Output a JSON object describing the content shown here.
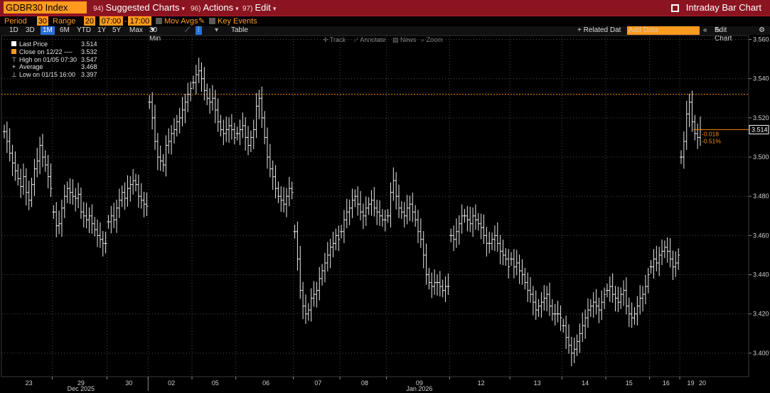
{
  "header": {
    "ticker": "GDBR30 Index",
    "menu_suggested_num": "94)",
    "menu_suggested": "Suggested Charts",
    "menu_actions_num": "96)",
    "menu_actions": "Actions",
    "menu_edit_num": "97)",
    "menu_edit": "Edit",
    "title": "Intraday Bar Chart"
  },
  "controls": {
    "period_label": "Period",
    "period_value": "30",
    "range_label": "Range",
    "range_value": "20",
    "time_start": "07:00",
    "time_sep": "-",
    "time_end": "17:00",
    "mov_avgs": "Mov Avgs",
    "key_events": "Key Events"
  },
  "timeframes": [
    "1D",
    "3D",
    "1M",
    "6M",
    "YTD",
    "1Y",
    "5Y",
    "Max"
  ],
  "timeframe_selected": "1M",
  "interval": "30 Min",
  "table_label": "Table",
  "related_label": "+ Related Dat",
  "add_data_placeholder": "Add Data",
  "edit_chart": "Edit Chart",
  "toolbar": {
    "track": "Track",
    "annotate": "Annotate",
    "news": "News",
    "zoom": "Zoom"
  },
  "legend": [
    {
      "label": "Last Price",
      "value": "3.514"
    },
    {
      "label": "Close on 12/22 ----",
      "value": "3.532"
    },
    {
      "label": "High on 01/05 07:30",
      "value": "3.547"
    },
    {
      "label": "Average",
      "value": "3.468"
    },
    {
      "label": "Low on 01/15 16:00",
      "value": "3.397"
    }
  ],
  "chart_data": {
    "type": "bar",
    "subtype": "intraday-ohlc",
    "ylim": [
      3.388,
      3.562
    ],
    "y_ticks": [
      "3.400",
      "3.420",
      "3.440",
      "3.460",
      "3.480",
      "3.500",
      "3.520",
      "3.540",
      "3.560"
    ],
    "x_ticks": [
      "23",
      "29",
      "30",
      "02",
      "05",
      "06",
      "07",
      "08",
      "09",
      "12",
      "13",
      "14",
      "15",
      "16",
      "19",
      "20"
    ],
    "month_labels": [
      {
        "label": "Dec 2025",
        "after": "29"
      },
      {
        "label": "Jan 2026",
        "after": "09"
      }
    ],
    "reference_line": {
      "label": "Close on 12/22",
      "value": 3.532,
      "color": "#ff8c00"
    },
    "last_price": {
      "value": "3.514",
      "change": "-0.018",
      "change_pct": "-0.51%"
    },
    "grid": true,
    "colors": {
      "bars": "#e8e8e8",
      "grid": "#4a4a4a",
      "reference": "#ff8c00"
    },
    "series": [
      {
        "day": "23",
        "closes": [
          3.513,
          3.508,
          3.502,
          3.497,
          3.493,
          3.489,
          3.485,
          3.49,
          3.482,
          3.478,
          3.486,
          3.494,
          3.498,
          3.506,
          3.5,
          3.496,
          3.49,
          3.484
        ]
      },
      {
        "day": "29",
        "closes": [
          3.472,
          3.465,
          3.466,
          3.474,
          3.48,
          3.484,
          3.482,
          3.48,
          3.479,
          3.481,
          3.472,
          3.47,
          3.468,
          3.47,
          3.466,
          3.463,
          3.46,
          3.458,
          3.456,
          3.456
        ]
      },
      {
        "day": "30",
        "closes": [
          3.467,
          3.47,
          3.468,
          3.474,
          3.478,
          3.482,
          3.479,
          3.484,
          3.486,
          3.488,
          3.486,
          3.48,
          3.478,
          3.476,
          3.475
        ]
      },
      {
        "day": "02",
        "closes": [
          3.528,
          3.52,
          3.508,
          3.5,
          3.498,
          3.496,
          3.506,
          3.508,
          3.512,
          3.514,
          3.518,
          3.52,
          3.524,
          3.528,
          3.532,
          3.535
        ]
      },
      {
        "day": "05",
        "closes": [
          3.538,
          3.542,
          3.544,
          3.54,
          3.534,
          3.53,
          3.528,
          3.53,
          3.524,
          3.518,
          3.514,
          3.512,
          3.514,
          3.516,
          3.514,
          3.51
        ]
      },
      {
        "day": "06",
        "closes": [
          3.512,
          3.514,
          3.516,
          3.51,
          3.506,
          3.51,
          3.514,
          3.526,
          3.53,
          3.52,
          3.51,
          3.5,
          3.494,
          3.49,
          3.484,
          3.48,
          3.478,
          3.476,
          3.48,
          3.484,
          3.482
        ]
      },
      {
        "day": "07",
        "closes": [
          3.462,
          3.448,
          3.432,
          3.424,
          3.42,
          3.422,
          3.428,
          3.43,
          3.432,
          3.438,
          3.442,
          3.446,
          3.45,
          3.454,
          3.456,
          3.46,
          3.458
        ]
      },
      {
        "day": "08",
        "closes": [
          3.462,
          3.468,
          3.472,
          3.474,
          3.478,
          3.48,
          3.476,
          3.472,
          3.47,
          3.474,
          3.476,
          3.478,
          3.474,
          3.472,
          3.47,
          3.468,
          3.468
        ]
      },
      {
        "day": "09",
        "closes": [
          3.47,
          3.482,
          3.488,
          3.48,
          3.474,
          3.472,
          3.47,
          3.474,
          3.476,
          3.472,
          3.468,
          3.462,
          3.458,
          3.45,
          3.44,
          3.436,
          3.434,
          3.436,
          3.436,
          3.434,
          3.432,
          3.434,
          3.434
        ]
      },
      {
        "day": "12",
        "closes": [
          3.46,
          3.458,
          3.462,
          3.466,
          3.47,
          3.47,
          3.468,
          3.466,
          3.47,
          3.468,
          3.466,
          3.464,
          3.46,
          3.456,
          3.456,
          3.458,
          3.46,
          3.456,
          3.452,
          3.45,
          3.448,
          3.444
        ]
      },
      {
        "day": "13",
        "closes": [
          3.448,
          3.444,
          3.446,
          3.442,
          3.44,
          3.436,
          3.432,
          3.43,
          3.426,
          3.422,
          3.424,
          3.426,
          3.428,
          3.43,
          3.424,
          3.42,
          3.42,
          3.42,
          3.418
        ]
      },
      {
        "day": "14",
        "closes": [
          3.414,
          3.408,
          3.404,
          3.4,
          3.402,
          3.406,
          3.41,
          3.414,
          3.418,
          3.422,
          3.424,
          3.426,
          3.424,
          3.422,
          3.426,
          3.43
        ]
      },
      {
        "day": "15",
        "closes": [
          3.432,
          3.434,
          3.43,
          3.428,
          3.426,
          3.43,
          3.432,
          3.424,
          3.42,
          3.418,
          3.42,
          3.424,
          3.428,
          3.43,
          3.434,
          3.44
        ]
      },
      {
        "day": "16",
        "closes": [
          3.444,
          3.448,
          3.446,
          3.45,
          3.452,
          3.454,
          3.452,
          3.448,
          3.444,
          3.446,
          3.45
        ]
      },
      {
        "day": "19",
        "closes": [
          3.5,
          3.508,
          3.522,
          3.528,
          3.518,
          3.512,
          3.51,
          3.514
        ]
      }
    ]
  }
}
